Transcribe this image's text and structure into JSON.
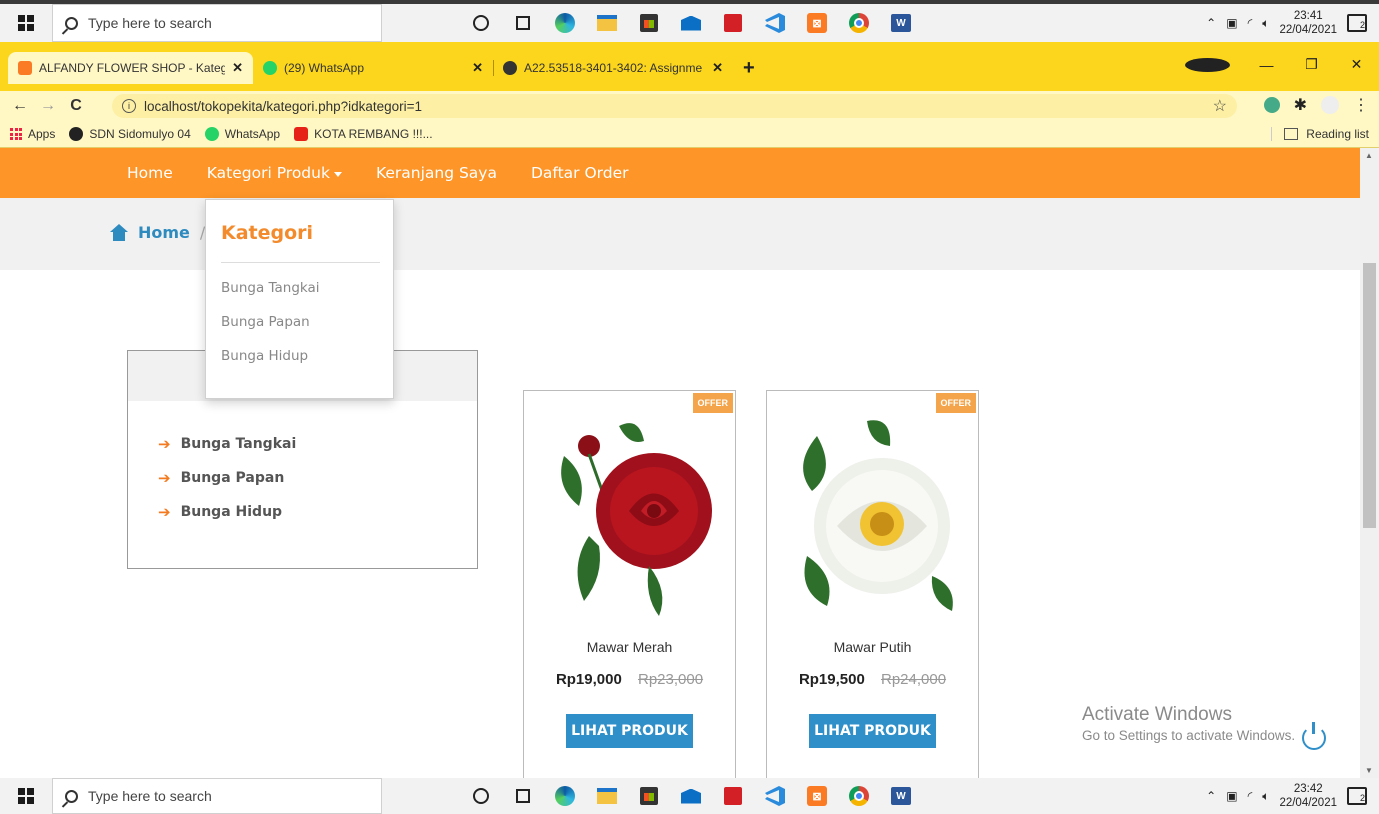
{
  "taskbar": {
    "search_placeholder": "Type here to search",
    "time_top": "23:41",
    "date_top": "22/04/2021",
    "time_bottom": "23:42",
    "date_bottom": "22/04/2021",
    "notification_count": "2",
    "xampp_glyph": "⊠",
    "word_glyph": "W"
  },
  "browser": {
    "tabs": [
      {
        "title": "ALFANDY FLOWER SHOP - Kateg",
        "close": "✕",
        "favicon_color": "#fb7a24"
      },
      {
        "title": "(29) WhatsApp",
        "close": "✕",
        "favicon_color": "#25d366"
      },
      {
        "title": "A22.53518-3401-3402: Assignme",
        "close": "✕",
        "favicon_color": "#333333"
      }
    ],
    "new_tab": "+",
    "window_controls": {
      "minimize": "—",
      "maximize": "❐",
      "close": "✕"
    },
    "nav": {
      "back": "←",
      "forward": "→",
      "reload": "C"
    },
    "url": "localhost/tokopekita/kategori.php?idkategori=1",
    "info_glyph": "i",
    "star": "☆",
    "menu": "⋮",
    "extension_glyph": "✱",
    "bookmarks": [
      {
        "label": "Apps"
      },
      {
        "label": "SDN Sidomulyo 04",
        "color": "#222222"
      },
      {
        "label": "WhatsApp",
        "color": "#25d366"
      },
      {
        "label": "KOTA REMBANG !!!...",
        "color": "#e62117"
      }
    ],
    "reading_list": "Reading list"
  },
  "site": {
    "nav": {
      "home": "Home",
      "kategori": "Kategori Produk",
      "keranjang": "Keranjang Saya",
      "order": "Daftar Order"
    },
    "breadcrumb": {
      "home": "Home",
      "separator": "/"
    },
    "dropdown": {
      "heading": "Kategori",
      "items": [
        "Bunga Tangkai",
        "Bunga Papan",
        "Bunga Hidup"
      ]
    },
    "sidebar": {
      "arrow": "➔",
      "items": [
        "Bunga Tangkai",
        "Bunga Papan",
        "Bunga Hidup"
      ]
    },
    "products": [
      {
        "badge": "OFFER",
        "name": "Mawar Merah",
        "price": "Rp19,000",
        "old_price": "Rp23,000",
        "button": "LIHAT PRODUK"
      },
      {
        "badge": "OFFER",
        "name": "Mawar Putih",
        "price": "Rp19,500",
        "old_price": "Rp24,000",
        "button": "LIHAT PRODUK"
      }
    ],
    "watermark": {
      "title": "Activate Windows",
      "subtitle": "Go to Settings to activate Windows."
    }
  },
  "colors": {
    "navbar": "#fd9528",
    "accent_blue": "#2f8fc9",
    "chrome_frame": "#fbd61c",
    "dropdown_heading": "#f38b2c"
  }
}
